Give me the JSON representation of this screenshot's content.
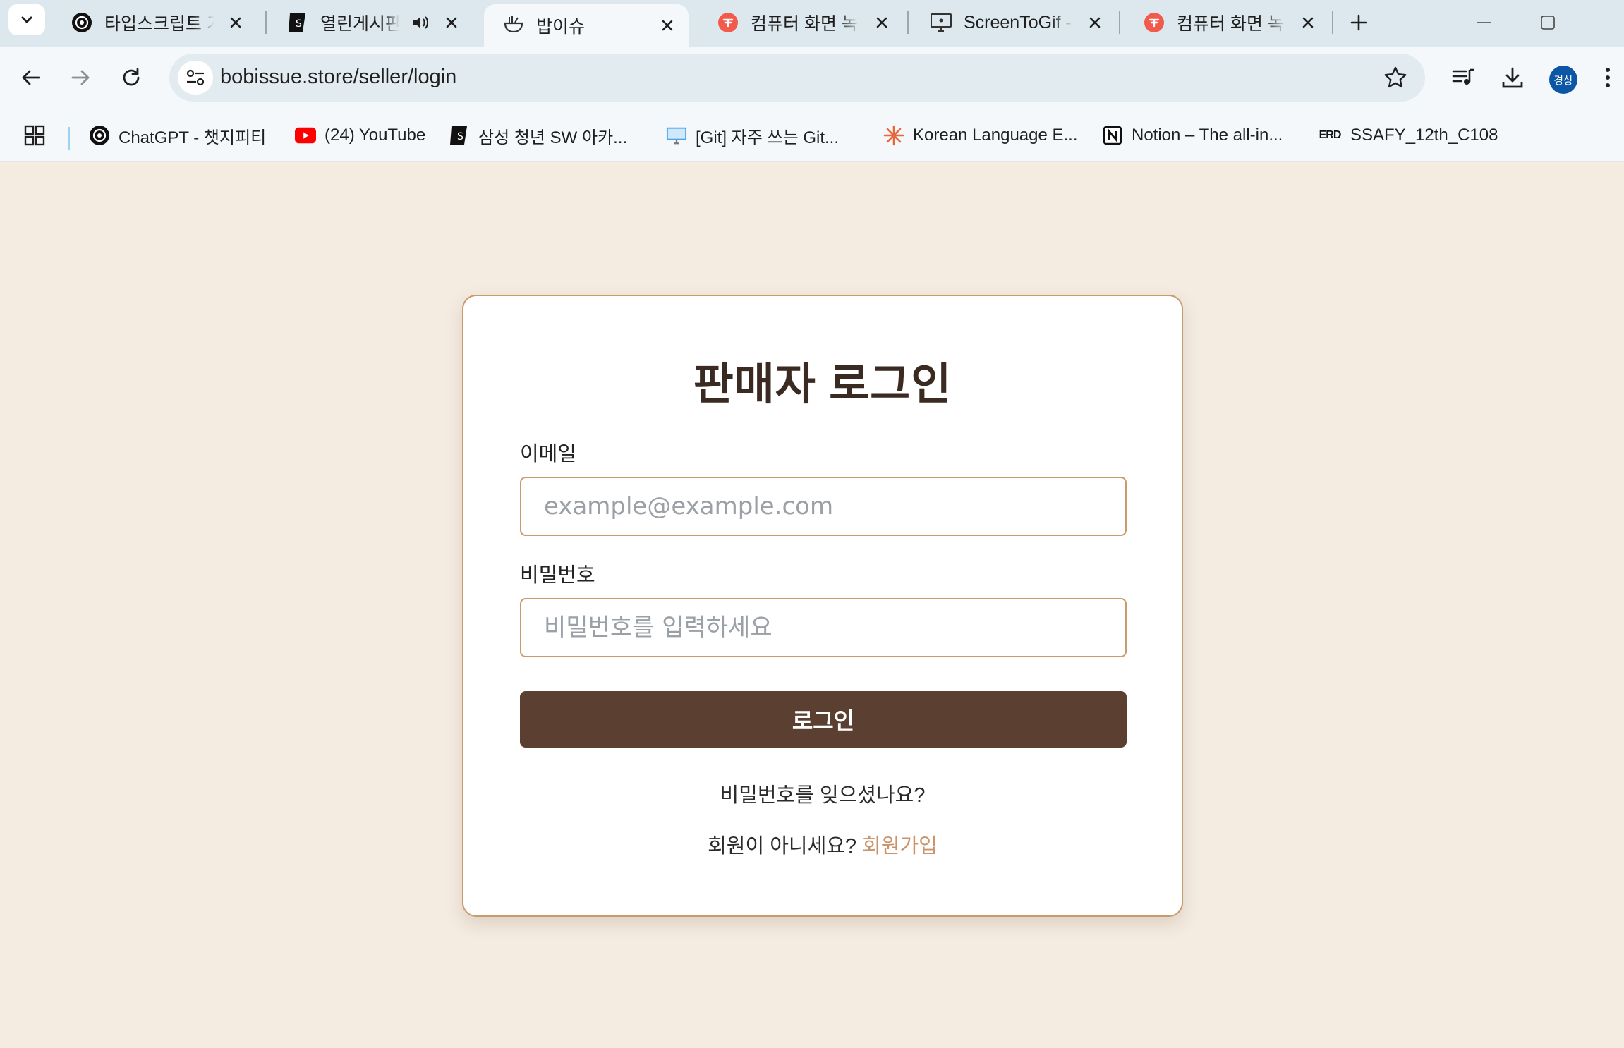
{
  "tabs": [
    {
      "title": "타입스크립트 기",
      "favicon": "chatgpt-icon"
    },
    {
      "title": "열린게시판",
      "favicon": "samsung-sw-icon",
      "audio": true
    },
    {
      "title": "밥이슈",
      "favicon": "bobissue-icon",
      "active": true
    },
    {
      "title": "컴퓨터 화면 녹",
      "favicon": "red-recorder-icon"
    },
    {
      "title": "ScreenToGif - R",
      "favicon": "monitor-icon"
    },
    {
      "title": "컴퓨터 화면 녹",
      "favicon": "red-recorder-icon"
    }
  ],
  "toolbar": {
    "url": "bobissue.store/seller/login",
    "profile_label": "경상"
  },
  "bookmarks": [
    {
      "label": "ChatGPT - 챗지피티",
      "icon": "chatgpt-icon"
    },
    {
      "label": "(24) YouTube",
      "icon": "youtube-icon"
    },
    {
      "label": "삼성 청년 SW 아카...",
      "icon": "samsung-sw-icon"
    },
    {
      "label": "[Git] 자주 쓰는 Git...",
      "icon": "monitor-icon"
    },
    {
      "label": "Korean Language E...",
      "icon": "sparkle-icon"
    },
    {
      "label": "Notion – The all-in...",
      "icon": "notion-icon"
    },
    {
      "label": "SSAFY_12th_C108",
      "icon": "erd-icon"
    }
  ],
  "bookmark_badges": {
    "erd": "ERD"
  },
  "login": {
    "title": "판매자 로그인",
    "email_label": "이메일",
    "email_placeholder": "example@example.com",
    "password_label": "비밀번호",
    "password_placeholder": "비밀번호를 입력하세요",
    "submit_label": "로그인",
    "forgot_password": "비밀번호를 잊으셨나요?",
    "signup_prompt": "회원이 아니세요? ",
    "signup_link": "회원가입"
  },
  "colors": {
    "page_background": "#f4ebe1",
    "accent_border": "#c99a6b",
    "button": "#5b3f31",
    "signup_link": "#c9946b"
  }
}
